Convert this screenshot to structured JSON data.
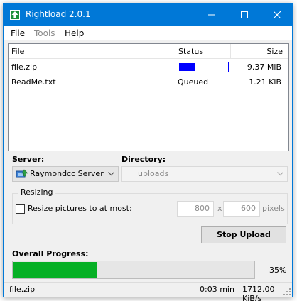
{
  "window": {
    "title": "Rightload 2.0.1",
    "accent_color": "#0078d7",
    "icon": "upload-arrow-icon",
    "controls": [
      "minimize-icon",
      "maximize-icon",
      "close-icon"
    ]
  },
  "menu": {
    "items": [
      {
        "label": "File",
        "enabled": true
      },
      {
        "label": "Tools",
        "enabled": false
      },
      {
        "label": "Help",
        "enabled": true
      }
    ]
  },
  "queue": {
    "columns": [
      "File",
      "Status",
      "Size"
    ],
    "rows": [
      {
        "file": "file.zip",
        "status": "",
        "progress": 0.34,
        "size": "9.37 MiB"
      },
      {
        "file": "ReadMe.txt",
        "status": "Queued",
        "progress": null,
        "size": "1.21 KiB"
      }
    ],
    "progress_color": "#0000ff"
  },
  "server": {
    "label": "Server:",
    "value": "Raymondcc Server"
  },
  "directory": {
    "label": "Directory:",
    "value": "uploads"
  },
  "resizing": {
    "group_label": "Resizing",
    "checkbox_label": "Resize pictures to at most:",
    "checked": false,
    "width": "800",
    "separator": "x",
    "height": "600",
    "unit": "pixels"
  },
  "actions": {
    "stop_label": "Stop Upload"
  },
  "overall": {
    "label": "Overall Progress:",
    "percent_text": "35%",
    "progress": 0.35,
    "fill_color": "#06b025"
  },
  "status": {
    "file": "file.zip",
    "time": "0:03 min",
    "speed": "1712.00 KiB/s"
  }
}
